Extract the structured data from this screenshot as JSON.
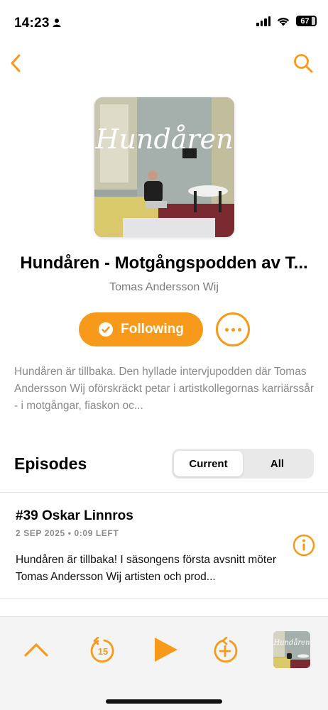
{
  "status_bar": {
    "time": "14:23",
    "battery": "67"
  },
  "podcast": {
    "artwork_text": "Hundåren",
    "title": "Hundåren - Motgångspodden av T...",
    "author": "Tomas Andersson Wij",
    "follow_label": "Following",
    "description": "Hundåren är tillbaka. Den hyllade intervjupodden där Tomas Andersson Wij oförskräckt petar i artistkollegornas karriärssår - i motgångar, fiaskon oc..."
  },
  "episodes": {
    "header": "Episodes",
    "filters": [
      "Current",
      "All"
    ],
    "selected_filter": "Current",
    "items": [
      {
        "title": "#39 Oskar Linnros",
        "meta": "2 SEP 2025 • 0:09 LEFT",
        "description": "Hundåren är tillbaka! I säsongens första avsnitt möter Tomas Andersson Wij artisten och prod..."
      }
    ]
  },
  "player": {
    "skip_back_seconds": "15"
  },
  "colors": {
    "accent": "#f79a1b",
    "secondary_text": "#8a8a8a"
  }
}
